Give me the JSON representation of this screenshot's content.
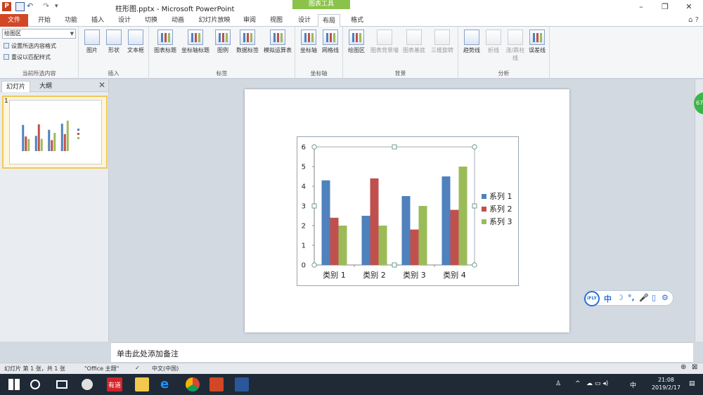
{
  "window": {
    "doc_title": "柱形图.pptx - Microsoft PowerPoint",
    "chart_tools_label": "图表工具",
    "minimize": "–",
    "restore": "❐",
    "close": "✕"
  },
  "tabs": [
    "文件",
    "开始",
    "功能",
    "插入",
    "设计",
    "切换",
    "动画",
    "幻灯片放映",
    "审阅",
    "视图",
    "设计",
    "布局",
    "格式"
  ],
  "active_tab": "布局",
  "ribbon": {
    "selection_box": "绘图区",
    "format_selection": "设置所选内容格式",
    "reset_style": "重设以匹配样式",
    "current_selection_group": "当前所选内容",
    "insert_group": "插入",
    "insert_buttons": [
      "图片",
      "形状",
      "文本框"
    ],
    "labels_group": "标签",
    "labels_buttons": [
      "图表标题",
      "坐标轴标题",
      "图例",
      "数据标签",
      "模拟运算表"
    ],
    "axes_group": "坐标轴",
    "axes_buttons": [
      "坐标轴",
      "网格线"
    ],
    "background_group": "背景",
    "background_buttons": [
      "绘图区",
      "图表背景墙",
      "图表基底",
      "三维旋转"
    ],
    "analysis_group": "分析",
    "analysis_buttons": [
      "趋势线",
      "折线",
      "涨/跌柱线",
      "误差线"
    ]
  },
  "panel": {
    "tab_slides": "幻灯片",
    "tab_outline": "大纲",
    "close": "✕",
    "slide_number": "1"
  },
  "chart_data": {
    "type": "bar",
    "categories": [
      "类别 1",
      "类别 2",
      "类别 3",
      "类别 4"
    ],
    "series": [
      {
        "name": "系列 1",
        "values": [
          4.3,
          2.5,
          3.5,
          4.5
        ],
        "color": "#4f81bd"
      },
      {
        "name": "系列 2",
        "values": [
          2.4,
          4.4,
          1.8,
          2.8
        ],
        "color": "#c0504d"
      },
      {
        "name": "系列 3",
        "values": [
          2,
          2,
          3,
          5
        ],
        "color": "#9bbb59"
      }
    ],
    "yticks": [
      "0",
      "1",
      "2",
      "3",
      "4",
      "5",
      "6"
    ],
    "ylim": [
      0,
      6
    ],
    "legend": "right",
    "grid": false
  },
  "ifly": {
    "logo": "iFLY",
    "items": [
      "中",
      "☽",
      "°,",
      "🎤",
      "▯",
      "⚙"
    ]
  },
  "notes_placeholder": "单击此处添加备注",
  "status": {
    "slide_info": "幻灯片 第 1 张，共 1 张",
    "theme": "\"Office 主题\"",
    "language": "中文(中国)"
  },
  "taskbar": {
    "time": "21:08",
    "date": "2019/2/17",
    "ime": "中",
    "apps": [
      "有道",
      "PowerPoint",
      "Word"
    ]
  }
}
